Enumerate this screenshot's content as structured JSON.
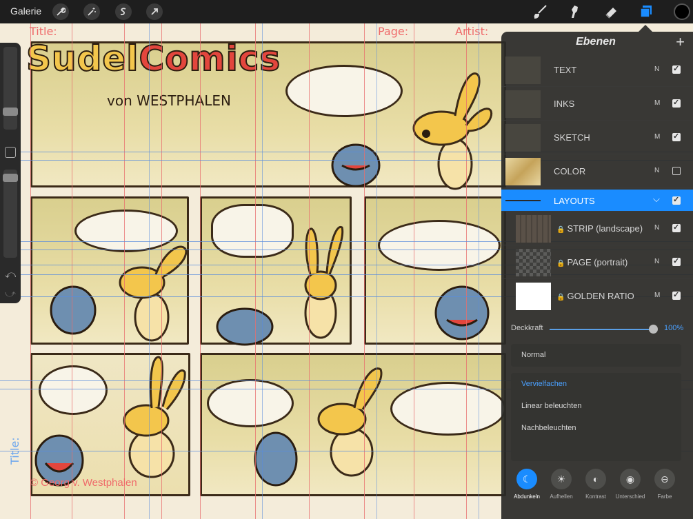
{
  "topbar": {
    "gallery_label": "Galerie",
    "tools": [
      "wrench-icon",
      "magic-wand-icon",
      "selection-icon",
      "transform-arrow-icon",
      "brush-icon",
      "smudge-icon",
      "eraser-icon",
      "layers-icon"
    ],
    "active_color": "#000000"
  },
  "canvas": {
    "labels": {
      "title": "Title:",
      "page": "Page:",
      "artist": "Artist:",
      "side_title": "Title:"
    },
    "logo": {
      "part1": "Sudel",
      "part2": "Comics",
      "byline": "von WESTPHALEN"
    },
    "copyright": "© Georg v. Westphalen"
  },
  "layers_panel": {
    "title": "Ebenen",
    "add_icon": "plus-icon",
    "layers": [
      {
        "name": "TEXT",
        "mode": "N",
        "visible": true
      },
      {
        "name": "INKS",
        "mode": "M",
        "visible": true
      },
      {
        "name": "SKETCH",
        "mode": "M",
        "visible": true
      },
      {
        "name": "COLOR",
        "mode": "N",
        "visible": false
      },
      {
        "name": "LAYOUTS",
        "mode": "",
        "visible": true,
        "selected": true,
        "group": true
      }
    ],
    "sublayers": [
      {
        "name": "STRIP (landscape)",
        "mode": "N",
        "visible": true,
        "locked": true
      },
      {
        "name": "PAGE (portrait)",
        "mode": "N",
        "visible": true,
        "locked": true
      },
      {
        "name": "GOLDEN RATIO",
        "mode": "M",
        "visible": true,
        "locked": true
      }
    ],
    "opacity_label": "Deckkraft",
    "opacity_value": "100%",
    "opacity_fraction": 1.0,
    "blend_current": "Normal",
    "blend_options": [
      "Vervielfachen",
      "Linear beleuchten",
      "Nachbeleuchten"
    ],
    "blend_active": "Vervielfachen",
    "mode_categories": [
      {
        "label": "Abdunkeln",
        "icon": "moon-icon",
        "active": true
      },
      {
        "label": "Aufhellen",
        "icon": "sun-icon",
        "active": false
      },
      {
        "label": "Kontrast",
        "icon": "contrast-icon",
        "active": false
      },
      {
        "label": "Unterschied",
        "icon": "difference-icon",
        "active": false
      },
      {
        "label": "Farbe",
        "icon": "color-icon",
        "active": false
      }
    ]
  }
}
